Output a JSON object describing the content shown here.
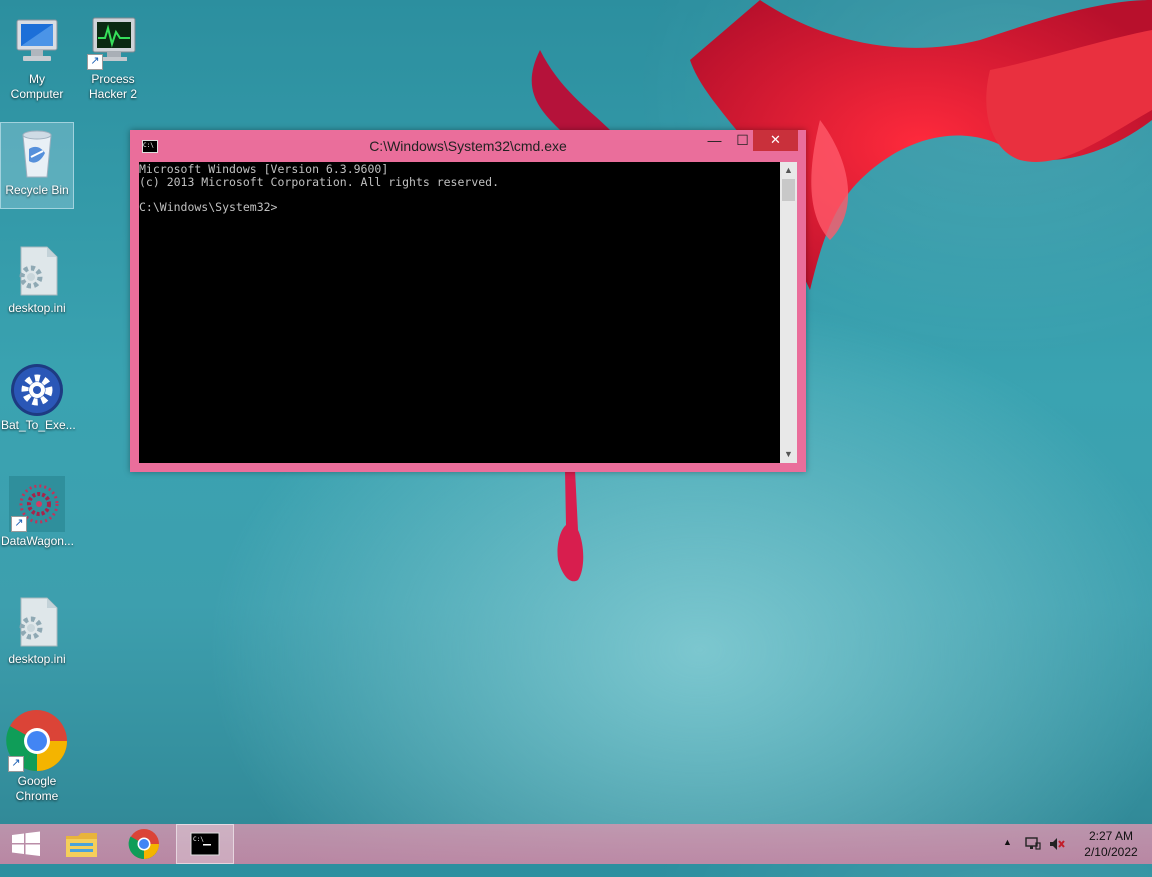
{
  "desktop": {
    "icons": [
      {
        "label": "My\nComputer",
        "line1": "My",
        "line2": "Computer",
        "icon": "computer-icon",
        "shortcut": false
      },
      {
        "label": "Process Hacker 2",
        "line1": "Process",
        "line2": "Hacker 2",
        "icon": "process-hacker-icon",
        "shortcut": true
      },
      {
        "label": "Recycle Bin",
        "line1": "Recycle Bin",
        "icon": "recycle-bin-icon",
        "selected": true
      },
      {
        "label": "desktop.ini",
        "line1": "desktop.ini",
        "icon": "settings-file-icon"
      },
      {
        "label": "Bat_To_Exe...",
        "line1": "Bat_To_Exe...",
        "icon": "gear-app-icon"
      },
      {
        "label": "DataWagon...",
        "line1": "DataWagon...",
        "icon": "datawagon-icon",
        "shortcut": true
      },
      {
        "label": "desktop.ini",
        "line1": "desktop.ini",
        "icon": "settings-file-icon"
      },
      {
        "label": "Google Chrome",
        "line1": "Google",
        "line2": "Chrome",
        "icon": "chrome-icon",
        "shortcut": true
      }
    ]
  },
  "cmd_window": {
    "title": "C:\\Windows\\System32\\cmd.exe",
    "minimize_glyph": "—",
    "maximize_glyph": "☐",
    "close_glyph": "✕",
    "lines": [
      "Microsoft Windows [Version 6.3.9600]",
      "(c) 2013 Microsoft Corporation. All rights reserved.",
      "",
      "C:\\Windows\\System32>"
    ],
    "title_icon_text": "C:\\"
  },
  "taskbar": {
    "items": [
      "start-button",
      "file-explorer",
      "google-chrome",
      "command-prompt"
    ],
    "active_item": "command-prompt",
    "clock_time": "2:27 AM",
    "clock_date": "2/10/2022",
    "tray_chevron": "▲"
  },
  "colors": {
    "window_frame": "#ea6e9b",
    "close_button": "#c9303b",
    "console_bg": "#000000",
    "console_text": "#c0c0c0"
  }
}
